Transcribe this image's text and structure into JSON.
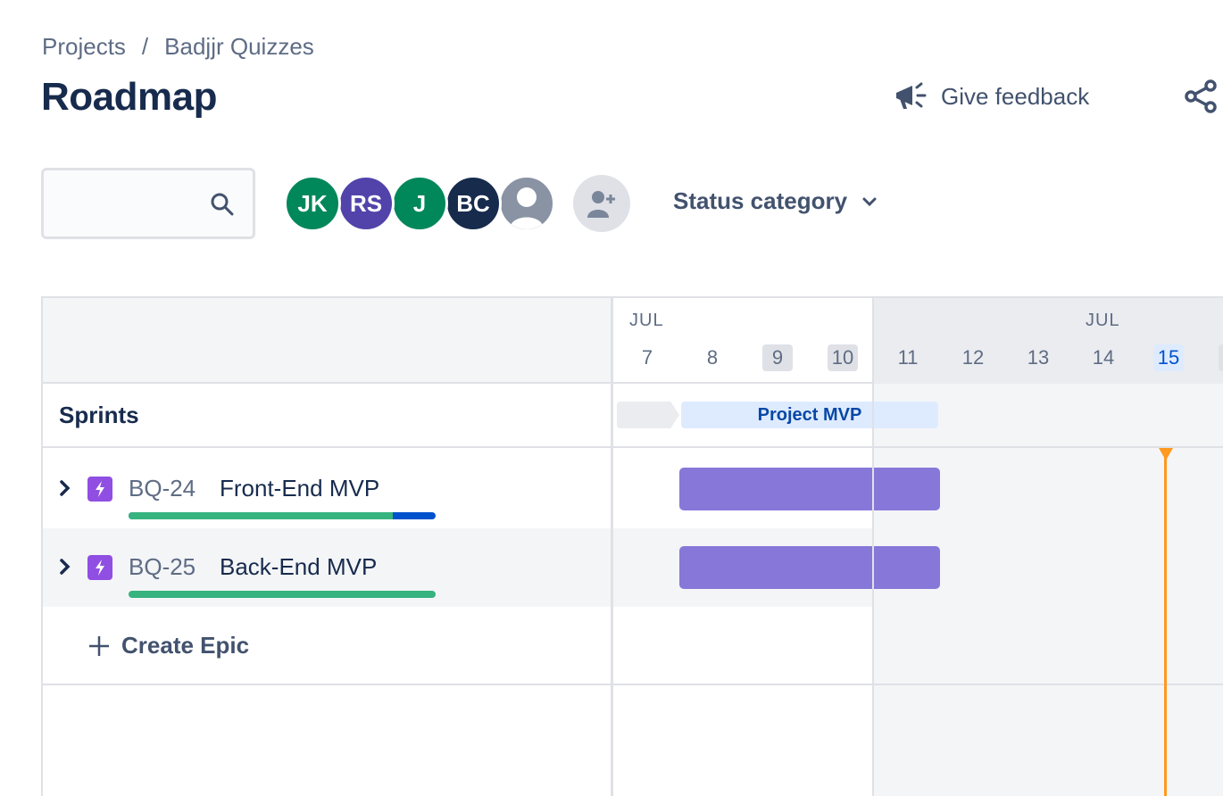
{
  "breadcrumb": {
    "root": "Projects",
    "separator": "/",
    "project": "Badjjr Quizzes"
  },
  "page": {
    "title": "Roadmap"
  },
  "header": {
    "feedback_label": "Give feedback",
    "feedback_icon": "megaphone-icon",
    "share_icon": "share-icon"
  },
  "search": {
    "placeholder": "",
    "value": ""
  },
  "avatars": [
    {
      "initials": "JK",
      "color": "#00875a"
    },
    {
      "initials": "RS",
      "color": "#5243aa"
    },
    {
      "initials": "J",
      "color": "#00875a"
    },
    {
      "initials": "BC",
      "color": "#172b4d"
    },
    {
      "initials": "",
      "color": "#8993a4"
    }
  ],
  "filters": {
    "status_category": "Status category"
  },
  "timeline": {
    "months": [
      "JUL",
      "JUL"
    ],
    "days": [
      "7",
      "8",
      "9",
      "10",
      "11",
      "12",
      "13",
      "14",
      "15"
    ]
  },
  "sprints": {
    "label": "Sprints",
    "current": "Project MVP"
  },
  "epics": [
    {
      "key": "BQ-24",
      "name": "Front-End MVP",
      "progress_done_pct": 86
    },
    {
      "key": "BQ-25",
      "name": "Back-End MVP",
      "progress_done_pct": 100
    }
  ],
  "create_epic_label": "Create Epic",
  "colors": {
    "epic_icon": "#904ee2",
    "epic_bar": "#8777d9",
    "progress_done": "#36b37e",
    "progress_in_progress": "#0052cc",
    "today_marker": "#ff991f"
  }
}
